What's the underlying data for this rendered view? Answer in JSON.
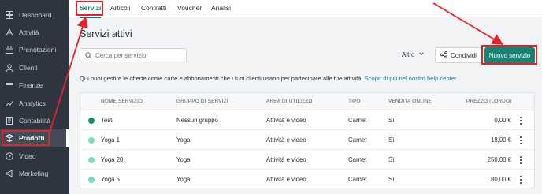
{
  "sidebar": {
    "items": [
      {
        "label": "Dashboard",
        "icon": "dashboard-icon"
      },
      {
        "label": "Attività",
        "icon": "activity-icon"
      },
      {
        "label": "Prenotazioni",
        "icon": "calendar-icon"
      },
      {
        "label": "Clienti",
        "icon": "user-icon"
      },
      {
        "label": "Finanze",
        "icon": "finance-icon"
      },
      {
        "label": "Analytics",
        "icon": "analytics-icon"
      },
      {
        "label": "Contabilità",
        "icon": "accounting-icon"
      },
      {
        "label": "Prodotti",
        "icon": "box-icon"
      },
      {
        "label": "Video",
        "icon": "play-icon"
      },
      {
        "label": "Marketing",
        "icon": "megaphone-icon"
      }
    ],
    "active": "Prodotti"
  },
  "tabs": [
    "Servizi",
    "Articoli",
    "Contratti",
    "Voucher",
    "Analisi"
  ],
  "main": {
    "title": "Servizi attivi",
    "search_placeholder": "Cerca per servizio",
    "altro_label": "Altro",
    "condividi_label": "Condividi",
    "nuovo_label": "Nuovo servizio",
    "info_text": "Qui puoi gestire le offerte come carte e abbonamenti che i tuoi clienti usano per partecipare alle tue attività.",
    "info_link": "Scopri di più nel nostro help center."
  },
  "table": {
    "headers": [
      "NOME SERVIZIO",
      "GRUPPO DI SERVIZI",
      "AREA DI UTILIZZO",
      "TIPO",
      "VENDITA ONLINE",
      "PREZZO (LORDO)"
    ],
    "rows": [
      {
        "name": "Test",
        "group": "Nessun gruppo",
        "area": "Attività e video",
        "type": "Carnet",
        "online": "Sì",
        "price": "0,00 €",
        "dot": "#1b8e63"
      },
      {
        "name": "Yoga 1",
        "group": "Yoga",
        "area": "Attività e video",
        "type": "Carnet",
        "online": "Sì",
        "price": "18,00 €",
        "dot": "#7ddbb7"
      },
      {
        "name": "Yoga 20",
        "group": "Yoga",
        "area": "Attività e video",
        "type": "Carnet",
        "online": "Sì",
        "price": "250,00 €",
        "dot": "#7ddbb7"
      },
      {
        "name": "Yoga 5",
        "group": "Yoga",
        "area": "Attività e video",
        "type": "Carnet",
        "online": "Sì",
        "price": "80,00 €",
        "dot": "#7ddbb7"
      }
    ]
  },
  "colors": {
    "sidebar_bg": "#2f3540",
    "accent": "#0f7d6f",
    "primary_button": "#1b8272",
    "annotation": "#e3232b",
    "link": "#137ea8"
  }
}
